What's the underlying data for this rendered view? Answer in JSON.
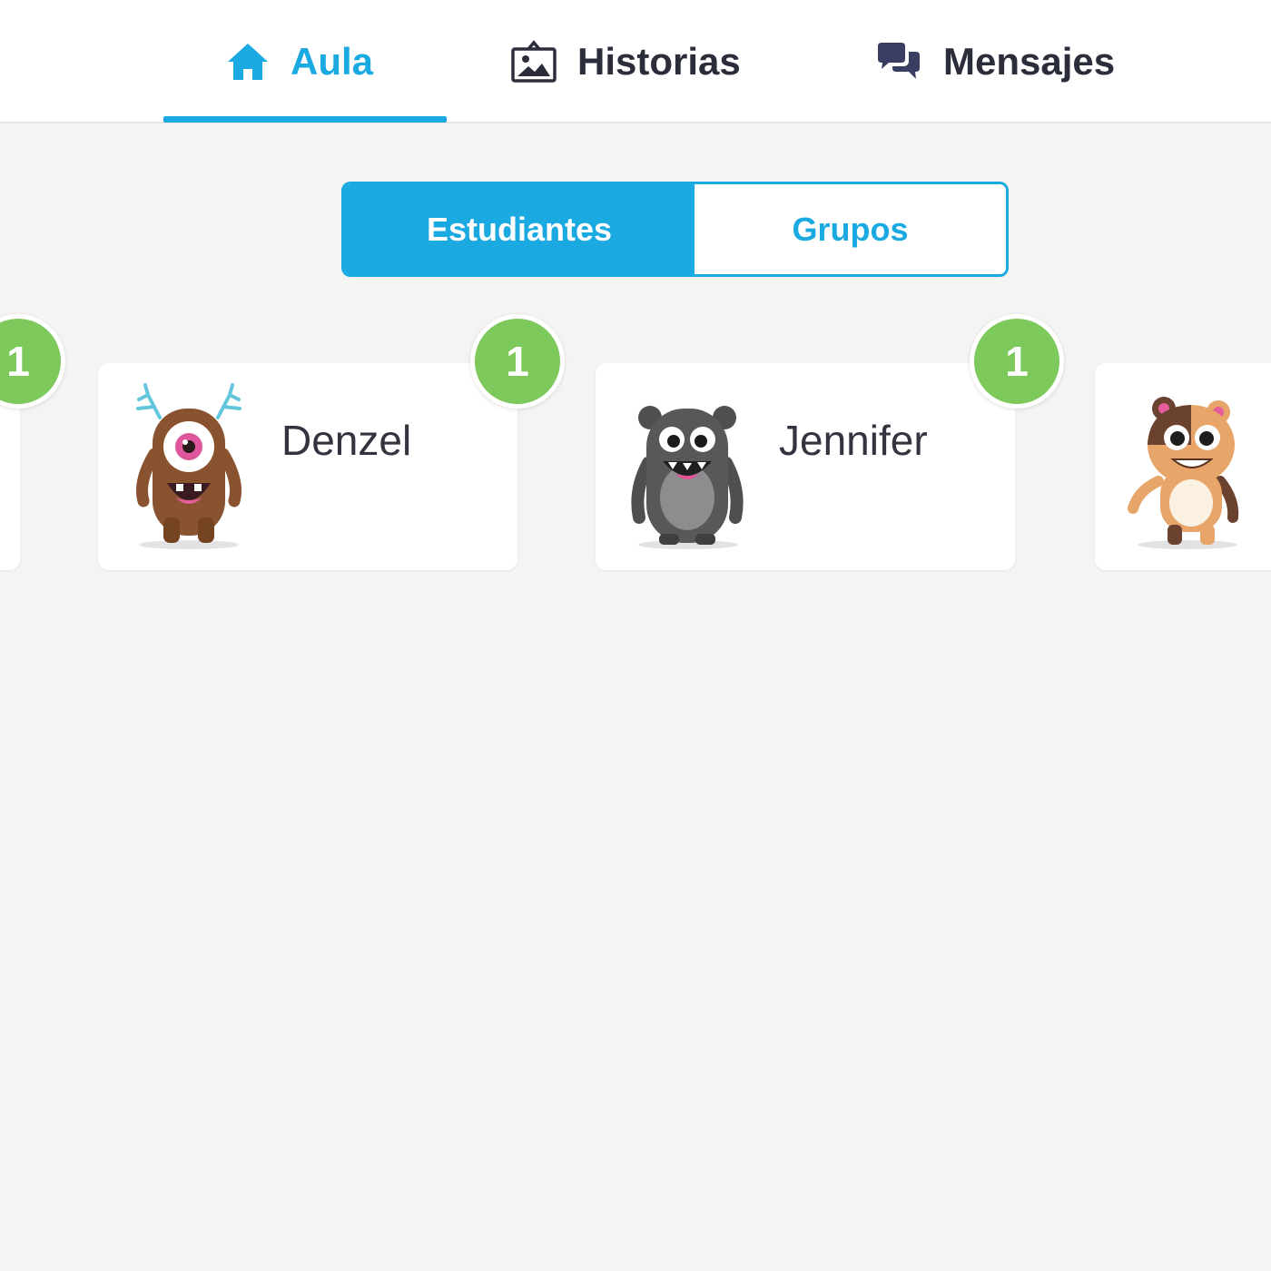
{
  "nav": {
    "tabs": [
      {
        "label": "Aula",
        "icon": "home-icon",
        "active": true
      },
      {
        "label": "Historias",
        "icon": "photo-icon",
        "active": false
      },
      {
        "label": "Mensajes",
        "icon": "chat-bubbles-icon",
        "active": false
      }
    ]
  },
  "view_toggle": {
    "students_label": "Estudiantes",
    "groups_label": "Grupos",
    "selected": "Estudiantes"
  },
  "students": [
    {
      "name": "",
      "points": "1",
      "partially_visible": true
    },
    {
      "name": "Denzel",
      "points": "1",
      "avatar": "brown-one-eyed-monster-avatar"
    },
    {
      "name": "Jennifer",
      "points": "1",
      "avatar": "gray-monster-avatar"
    },
    {
      "name": "",
      "points": "",
      "avatar": "calico-hamster-monster-avatar",
      "partially_visible": true
    }
  ],
  "colors": {
    "accent": "#1aa9e1",
    "points_badge": "#7dc95c",
    "background": "#f4f4f2",
    "text_dark": "#2b2d3b"
  }
}
